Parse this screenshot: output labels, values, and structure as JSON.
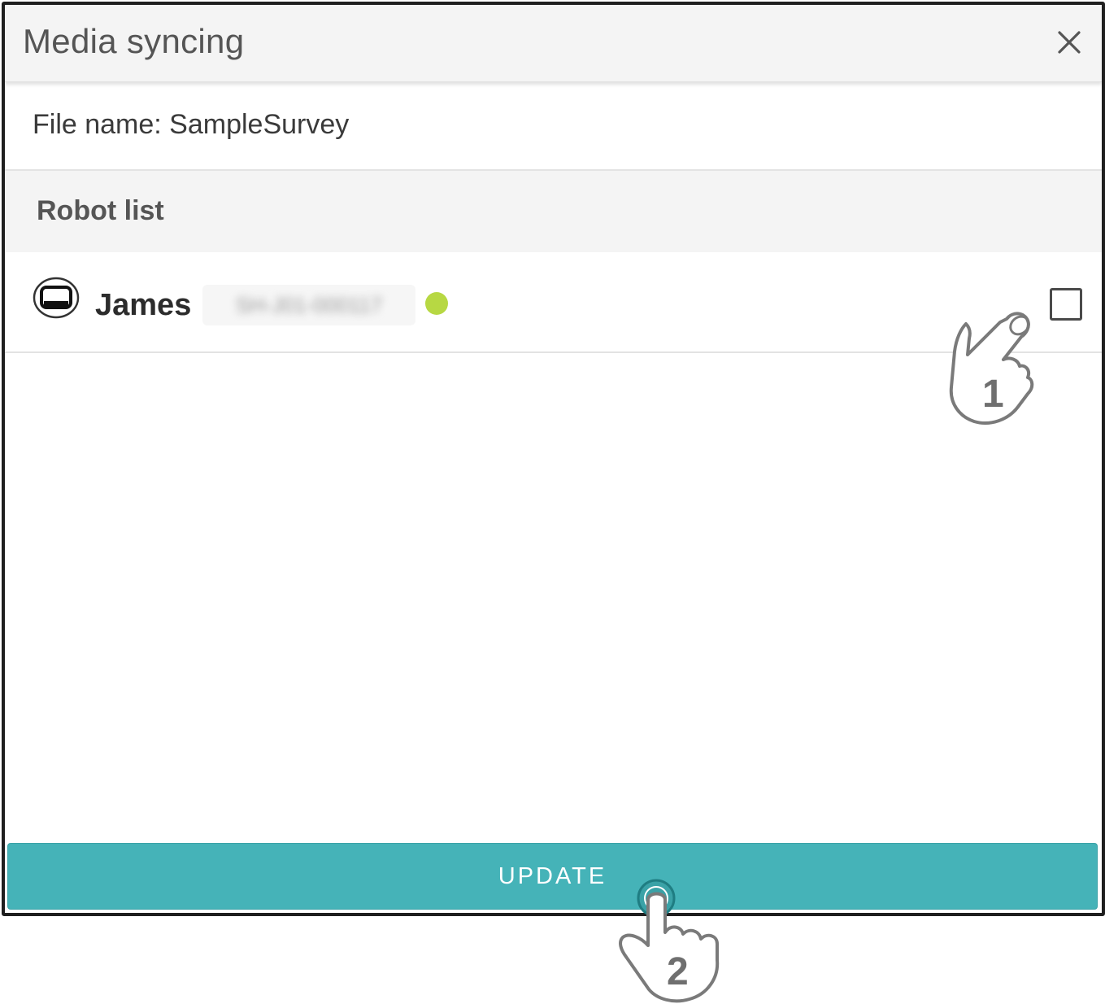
{
  "dialog": {
    "title": "Media syncing",
    "close_icon": "close-icon"
  },
  "file": {
    "label": "File name: SampleSurvey"
  },
  "robot_list": {
    "title": "Robot list",
    "items": [
      {
        "name": "James",
        "id": "SH-J01-000117",
        "status": "online",
        "status_color": "#b7d843",
        "icon": "robot-screen-icon",
        "checked": false
      }
    ]
  },
  "actions": {
    "update_label": "UPDATE",
    "update_color": "#45b3b8"
  },
  "annotations": {
    "step_1": "1",
    "step_2": "2"
  }
}
